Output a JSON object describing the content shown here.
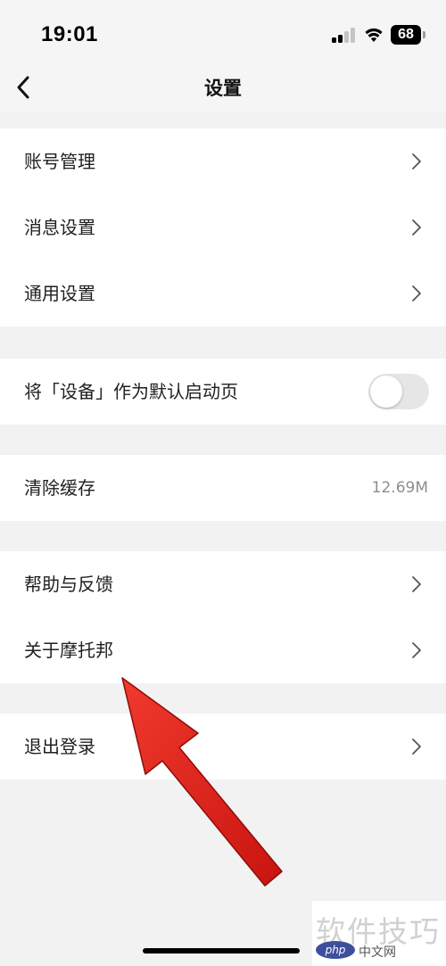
{
  "status_bar": {
    "time": "19:01",
    "battery": "68"
  },
  "header": {
    "title": "设置",
    "back_icon": "chevron-left-icon"
  },
  "groups": {
    "account": {
      "items": [
        {
          "label": "账号管理",
          "icon": "chevron-right-icon"
        },
        {
          "label": "消息设置",
          "icon": "chevron-right-icon"
        },
        {
          "label": "通用设置",
          "icon": "chevron-right-icon"
        }
      ]
    },
    "startup": {
      "label": "将「设备」作为默认启动页",
      "toggle_on": false
    },
    "cache": {
      "label": "清除缓存",
      "value": "12.69M"
    },
    "about": {
      "items": [
        {
          "label": "帮助与反馈",
          "icon": "chevron-right-icon"
        },
        {
          "label": "关于摩托邦",
          "icon": "chevron-right-icon"
        }
      ]
    },
    "logout": {
      "label": "退出登录",
      "icon": "chevron-right-icon"
    }
  },
  "annotation": {
    "arrow_color": "#e8221e"
  },
  "watermark": {
    "text": "软件技巧",
    "logo": "php",
    "sub": "中文网"
  },
  "colors": {
    "page_background": "#f2f2f2",
    "row_background": "#ffffff",
    "toggle_off": "#e6e6e6",
    "secondary_text": "#8e8e8e"
  }
}
